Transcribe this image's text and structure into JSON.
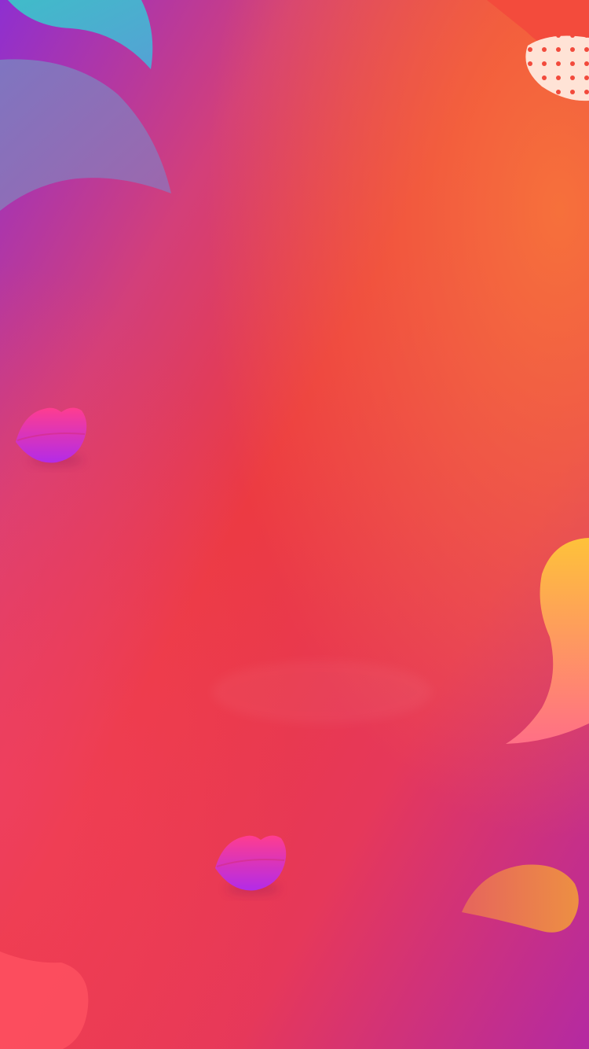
{
  "background": {
    "description_colors": {
      "top_left": "#8e2fd0",
      "top_right": "#f7733a",
      "center": "#ec3a42",
      "bottom_left": "#f1405f",
      "bottom_right": "#b42aa2"
    }
  },
  "decorations": {
    "petal_colors": {
      "teal": "#3cc3c9",
      "purple_blue": "#7d7bc0",
      "orange_red": "#f24a3c",
      "yellow": "#fec23a",
      "pink": "#ff6f86",
      "coral": "#fc4e5f"
    },
    "lips_colors": {
      "top": "#ff3d8f",
      "bottom": "#b32be8"
    }
  }
}
